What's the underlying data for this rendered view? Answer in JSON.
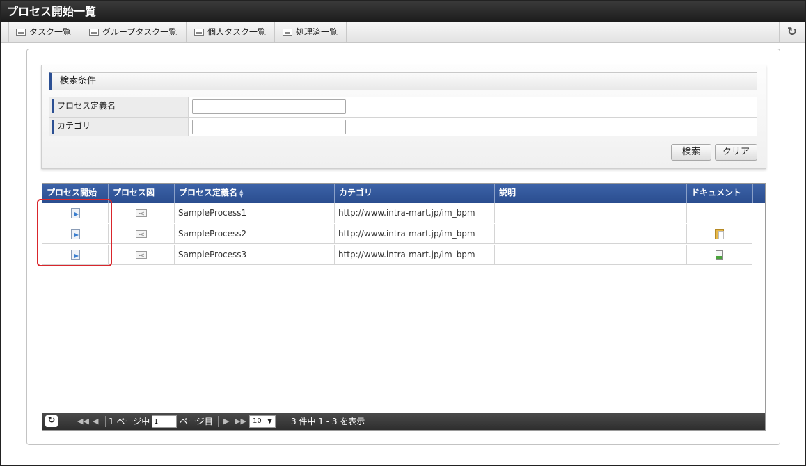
{
  "title": "プロセス開始一覧",
  "nav": {
    "tabs": [
      {
        "label": "タスク一覧"
      },
      {
        "label": "グループタスク一覧"
      },
      {
        "label": "個人タスク一覧"
      },
      {
        "label": "処理済一覧"
      }
    ],
    "reload_icon": "↻"
  },
  "search": {
    "header": "検索条件",
    "fields": [
      {
        "label": "プロセス定義名",
        "value": "",
        "placeholder": ""
      },
      {
        "label": "カテゴリ",
        "value": "",
        "placeholder": ""
      }
    ],
    "search_button": "検索",
    "clear_button": "クリア"
  },
  "grid": {
    "columns": [
      "プロセス開始",
      "プロセス図",
      "プロセス定義名",
      "カテゴリ",
      "説明",
      "ドキュメント"
    ],
    "sorted_column": "プロセス定義名",
    "rows": [
      {
        "name": "SampleProcess1",
        "category": "http://www.intra-mart.jp/im_bpm",
        "description": "",
        "document_icon": "none"
      },
      {
        "name": "SampleProcess2",
        "category": "http://www.intra-mart.jp/im_bpm",
        "description": "",
        "document_icon": "folder-icon"
      },
      {
        "name": "SampleProcess3",
        "category": "http://www.intra-mart.jp/im_bpm",
        "description": "",
        "document_icon": "document-icon"
      }
    ]
  },
  "pager": {
    "refresh_icon": "↻",
    "page_prefix": "1 ページ中",
    "page_value": "1",
    "page_suffix": "ページ目",
    "page_size": "10",
    "summary": "3 件中 1 - 3 を表示"
  },
  "colors": {
    "header_blue": "#2f539a",
    "highlight_red": "#d9262c",
    "title_bar": "#262626"
  }
}
